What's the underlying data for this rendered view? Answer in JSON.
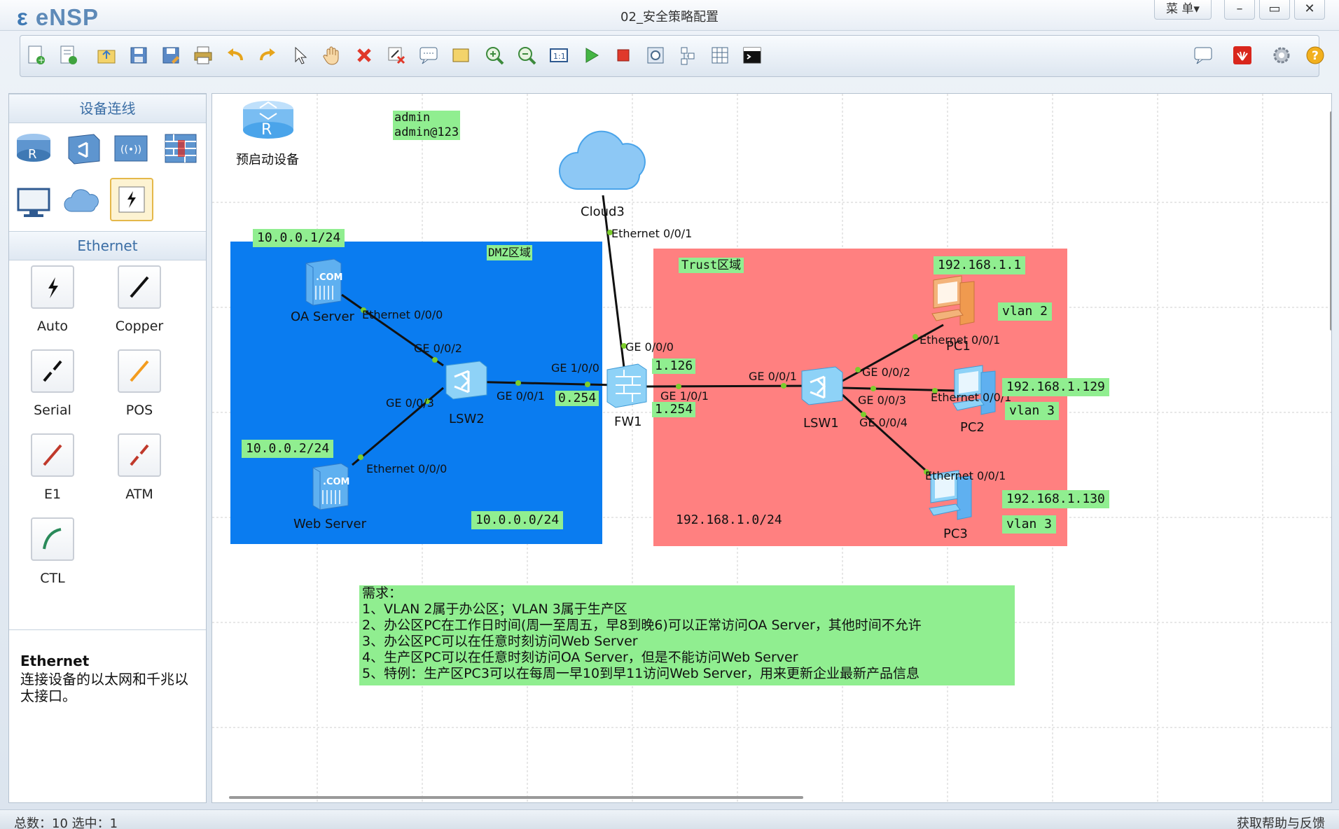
{
  "window": {
    "app_name": "eNSP",
    "title": "02_安全策略配置",
    "menu_label": "菜 单▾",
    "minimize": "–",
    "maximize": "▭",
    "close": "✕"
  },
  "toolbar": {
    "buttons": [
      "new-topology",
      "new-example",
      "open",
      "save",
      "save-as",
      "print",
      "undo",
      "redo",
      "select",
      "pan",
      "delete",
      "delete-link",
      "text",
      "palette",
      "zoom-in",
      "zoom-out",
      "fit",
      "start",
      "stop",
      "capture",
      "topology",
      "grid",
      "cli"
    ],
    "right_buttons": [
      "chat",
      "huawei",
      "settings",
      "help"
    ]
  },
  "left_panel": {
    "device_header": "设备连线",
    "cable_header": "Ethernet",
    "cables": [
      {
        "label": "Auto"
      },
      {
        "label": "Copper"
      },
      {
        "label": "Serial"
      },
      {
        "label": "POS"
      },
      {
        "label": "E1"
      },
      {
        "label": "ATM"
      },
      {
        "label": "CTL"
      }
    ],
    "desc_title": "Ethernet",
    "desc_text": "连接设备的以太网和千兆以太接口。"
  },
  "canvas": {
    "preboot_label": "预启动设备",
    "credentials": [
      "admin",
      "admin@123"
    ],
    "zones": {
      "dmz": {
        "label": "DMZ区域",
        "subnet": "10.0.0.0/24"
      },
      "trust": {
        "label": "Trust区域",
        "subnet": "192.168.1.0/24"
      }
    },
    "devices": {
      "cloud3": "Cloud3",
      "fw1": "FW1",
      "lsw1": "LSW1",
      "lsw2": "LSW2",
      "oa_server": "OA Server",
      "web_server": "Web Server",
      "pc1": "PC1",
      "pc2": "PC2",
      "pc3": "PC3"
    },
    "ip_labels": {
      "oa": "10.0.0.1/24",
      "web": "10.0.0.2/24",
      "fw_dmz": "0.254",
      "fw_trust1": "1.126",
      "fw_trust2": "1.254",
      "pc1_ip": "192.168.1.1",
      "pc1_vlan": "vlan 2",
      "pc2_ip": "192.168.1.129",
      "pc2_vlan": "vlan 3",
      "pc3_ip": "192.168.1.130",
      "pc3_vlan": "vlan 3"
    },
    "ports": {
      "cloud_eth": "Ethernet 0/0/1",
      "fw_ge000": "GE 0/0/0",
      "fw_ge100": "GE 1/0/0",
      "fw_ge101": "GE 1/0/1",
      "lsw2_ge002": "GE 0/0/2",
      "lsw2_ge001": "GE 0/0/1",
      "lsw2_ge003": "GE 0/0/3",
      "oa_eth": "Ethernet 0/0/0",
      "web_eth": "Ethernet 0/0/0",
      "lsw1_ge001": "GE 0/0/1",
      "lsw1_ge002": "GE 0/0/2",
      "lsw1_ge003": "GE 0/0/3",
      "lsw1_ge004": "GE 0/0/4",
      "pc1_eth": "Ethernet 0/0/1",
      "pc2_eth": "Ethernet 0/0/1",
      "pc3_eth": "Ethernet 0/0/1"
    },
    "requirements": [
      "需求：",
      "1、VLAN 2属于办公区；VLAN 3属于生产区",
      "2、办公区PC在工作日时间(周一至周五，早8到晚6)可以正常访问OA Server，其他时间不允许",
      "3、办公区PC可以在任意时刻访问Web Server",
      "4、生产区PC可以在任意时刻访问OA Server，但是不能访问Web Server",
      "5、特例：生产区PC3可以在每周一早10到早11访问Web Server，用来更新企业最新产品信息"
    ]
  },
  "status": {
    "left": "总数：10 选中：1",
    "right": "获取帮助与反馈"
  },
  "colors": {
    "dmz_zone": "#0a7cf0",
    "trust_zone": "#ff8080",
    "label_green": "#90ee90",
    "accent": "#3b6ea5"
  }
}
